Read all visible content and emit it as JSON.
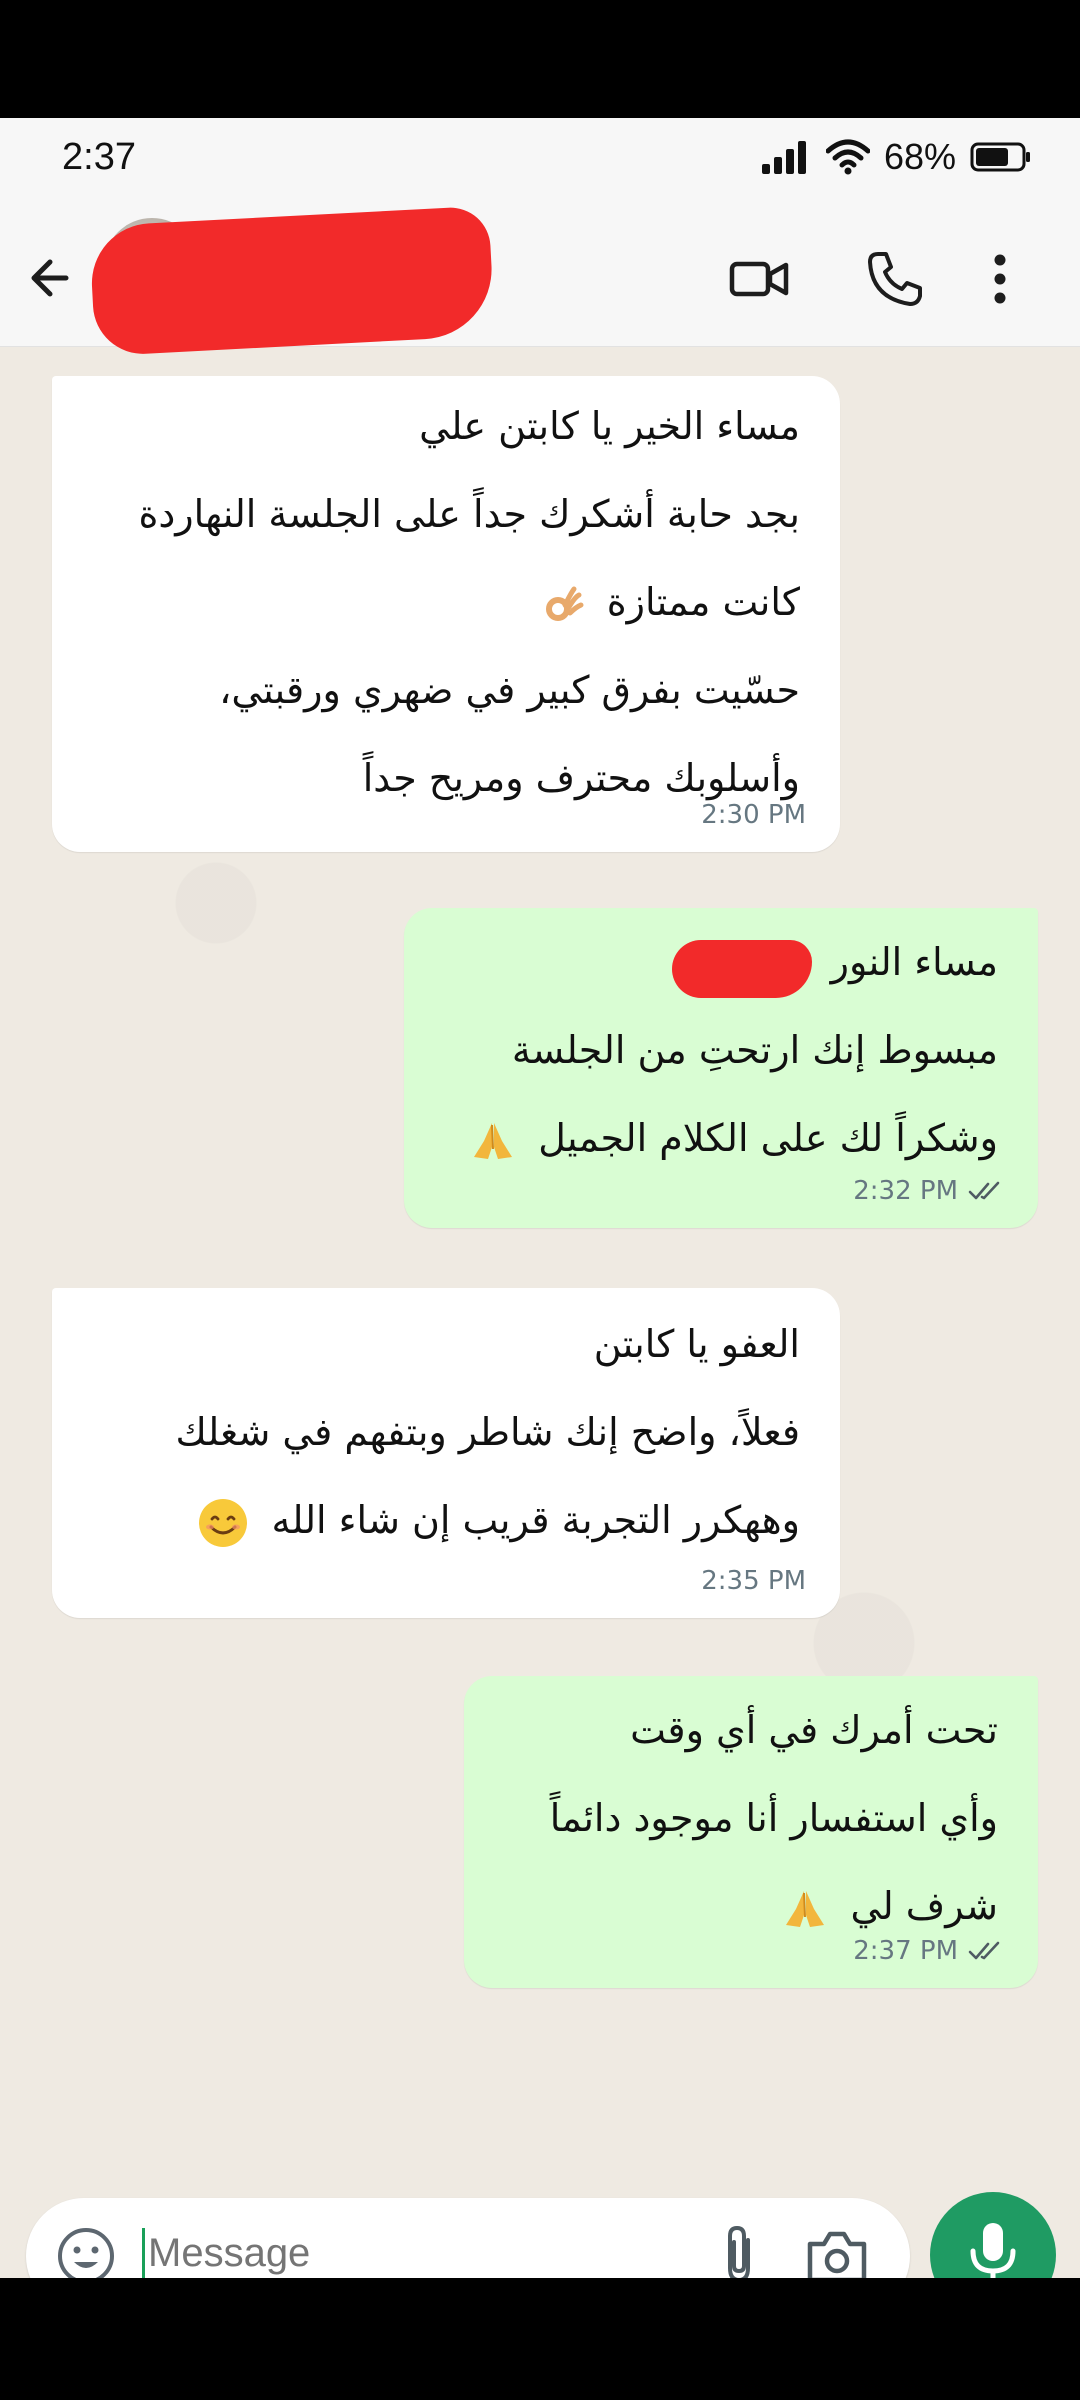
{
  "status_bar": {
    "time": "2:37",
    "battery": "68%",
    "icons": [
      "signal-icon",
      "wifi-icon",
      "battery-icon"
    ]
  },
  "app_bar": {
    "contact_name": "",
    "icons": [
      "back-arrow-icon",
      "video-call-icon",
      "voice-call-icon",
      "more-vert-icon"
    ]
  },
  "messages": [
    {
      "direction": "incoming",
      "lines": [
        "مساء الخير يا كابتن علي",
        "بجد حابة أشكرك جداً على الجلسة النهاردة",
        "كانت ممتازة",
        "حسّيت بفرق كبير في ضهري ورقبتي،",
        "وأسلوبك محترف ومريح جداً"
      ],
      "emoji": "ok-hand",
      "time": "2:30 PM"
    },
    {
      "direction": "outgoing",
      "lines": [
        "مساء النور",
        "مبسوط إنك ارتحتِ من الجلسة",
        "وشكراً لك على الكلام الجميل"
      ],
      "emoji": "folded-hands",
      "time": "2:32 PM",
      "status": "read"
    },
    {
      "direction": "incoming",
      "lines": [
        "العفو يا كابتن",
        "فعلاً، واضح إنك شاطر وبتفهم في شغلك",
        "وههكرر التجربة قريب إن شاء الله"
      ],
      "emoji": "smiling-face",
      "time": "2:35 PM"
    },
    {
      "direction": "outgoing",
      "lines": [
        "تحت أمرك في أي وقت",
        "وأي استفسار أنا موجود دائماً",
        "شرف لي"
      ],
      "emoji": "folded-hands",
      "time": "2:37 PM",
      "status": "read"
    }
  ],
  "composer": {
    "placeholder": "Message",
    "icons": [
      "emoji-icon",
      "attach-icon",
      "camera-icon",
      "mic-icon"
    ]
  },
  "colors": {
    "incoming_bubble": "#ffffff",
    "outgoing_bubble": "#d9fdd3",
    "chat_background": "#efeae2",
    "accent_green": "#1f9b63",
    "redaction": "#f22a2a"
  }
}
